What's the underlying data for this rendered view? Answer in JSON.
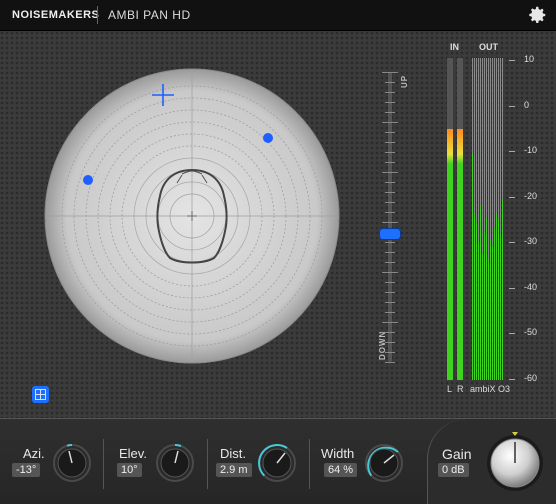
{
  "titlebar": {
    "brand": "NOISEMAKERS",
    "product": "AMBI PAN HD",
    "settings_icon": "gear-icon"
  },
  "panner": {
    "center_icon": "crosshair-icon",
    "head_icon": "listener-head-icon",
    "source_icon": "crosshair-target-icon"
  },
  "fader": {
    "top_label": "UP",
    "bottom_label": "DOWN",
    "level_fraction": 0.44
  },
  "meters": {
    "in_label": "IN",
    "out_label": "OUT",
    "scale": [
      "10",
      "0",
      "-10",
      "-20",
      "-30",
      "-40",
      "-50",
      "-60"
    ],
    "left_label": "L",
    "right_label": "R",
    "out_format": "ambiX O3",
    "colors": {
      "green": "#3fd21f",
      "yellow": "#e8e23a",
      "orange": "#ff8a1e",
      "empty": "#5a5a5a"
    }
  },
  "grid_button_icon": "grid-icon",
  "controls": [
    {
      "label": "Azi.",
      "value": "-13°"
    },
    {
      "label": "Elev.",
      "value": "10°"
    },
    {
      "label": "Dist.",
      "value": "2.9 m"
    },
    {
      "label": "Width",
      "value": "64 %"
    }
  ],
  "gain": {
    "label": "Gain",
    "value": "0 dB"
  }
}
